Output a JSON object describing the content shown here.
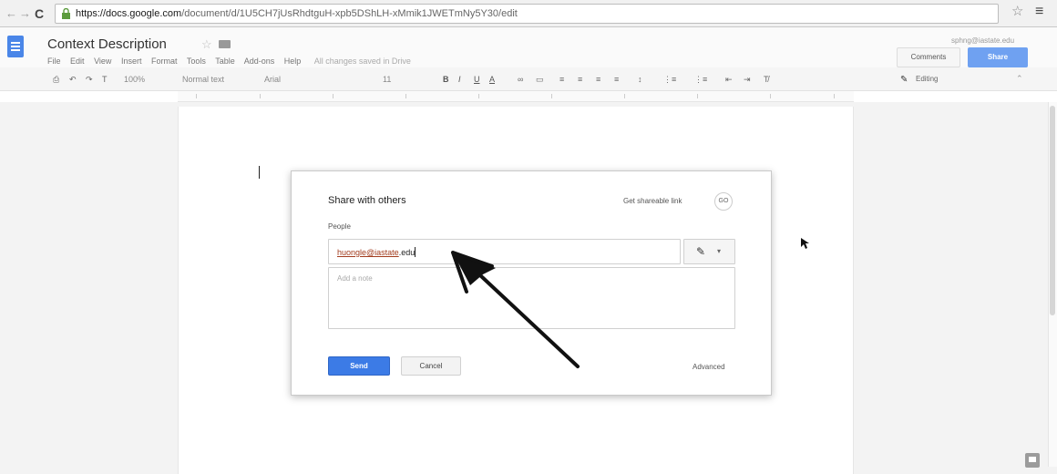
{
  "browser": {
    "url_host": "https://docs.google.com",
    "url_path": "/document/d/1U5CH7jUsRhdtguH-xpb5DShLH-xMmik1JWETmNy5Y30/edit"
  },
  "docs_header": {
    "title": "Context Description",
    "menu": [
      "File",
      "Edit",
      "View",
      "Insert",
      "Format",
      "Tools",
      "Table",
      "Add-ons",
      "Help"
    ],
    "saved_status": "All changes saved in Drive",
    "account": "sphng@iastate.edu",
    "comments_label": "Comments",
    "share_label": "Share"
  },
  "toolbar": {
    "zoom": "100%",
    "style": "Normal text",
    "font": "Arial",
    "font_size": "11",
    "mode": "Editing"
  },
  "share_dialog": {
    "title": "Share with others",
    "shareable_link_label": "Get shareable link",
    "shareable_link_icon": "GO",
    "people_label": "People",
    "people_address": "huongle@iastate",
    "people_suffix": ".edu",
    "note_placeholder": "Add a note",
    "send_label": "Send",
    "cancel_label": "Cancel",
    "advanced_label": "Advanced",
    "accent_color": "#3c7be6"
  },
  "icons": {
    "back": "arrow-back-icon",
    "forward": "arrow-forward-icon",
    "reload": "reload-icon",
    "lock": "lock-icon",
    "bookmark": "star-icon",
    "menu": "hamburger-menu-icon",
    "permission": "pencil-icon"
  }
}
